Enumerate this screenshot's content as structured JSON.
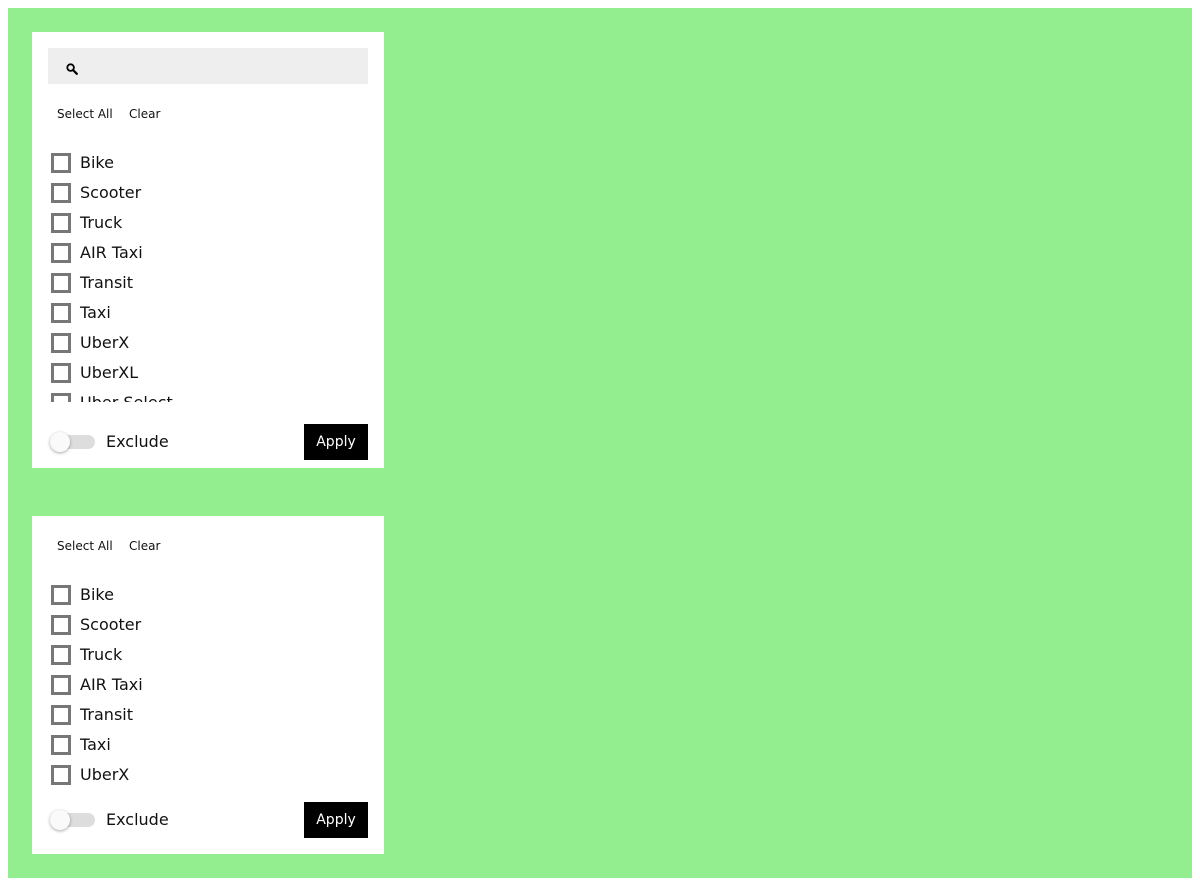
{
  "colors": {
    "background": "#92ee8f",
    "panel": "#ffffff",
    "apply_button": "#000000"
  },
  "panel_top": {
    "search": {
      "icon": "search-icon",
      "placeholder": "",
      "value": ""
    },
    "select_all_label": "Select All",
    "clear_label": "Clear",
    "items": [
      {
        "label": "Bike",
        "checked": false
      },
      {
        "label": "Scooter",
        "checked": false
      },
      {
        "label": "Truck",
        "checked": false
      },
      {
        "label": "AIR Taxi",
        "checked": false
      },
      {
        "label": "Transit",
        "checked": false
      },
      {
        "label": "Taxi",
        "checked": false
      },
      {
        "label": "UberX",
        "checked": false
      },
      {
        "label": "UberXL",
        "checked": false
      },
      {
        "label": "Uber Select",
        "checked": false
      }
    ],
    "exclude_label": "Exclude",
    "exclude_on": false,
    "apply_label": "Apply"
  },
  "panel_bottom": {
    "select_all_label": "Select All",
    "clear_label": "Clear",
    "items": [
      {
        "label": "Bike",
        "checked": false
      },
      {
        "label": "Scooter",
        "checked": false
      },
      {
        "label": "Truck",
        "checked": false
      },
      {
        "label": "AIR Taxi",
        "checked": false
      },
      {
        "label": "Transit",
        "checked": false
      },
      {
        "label": "Taxi",
        "checked": false
      },
      {
        "label": "UberX",
        "checked": false
      }
    ],
    "exclude_label": "Exclude",
    "exclude_on": false,
    "apply_label": "Apply"
  }
}
